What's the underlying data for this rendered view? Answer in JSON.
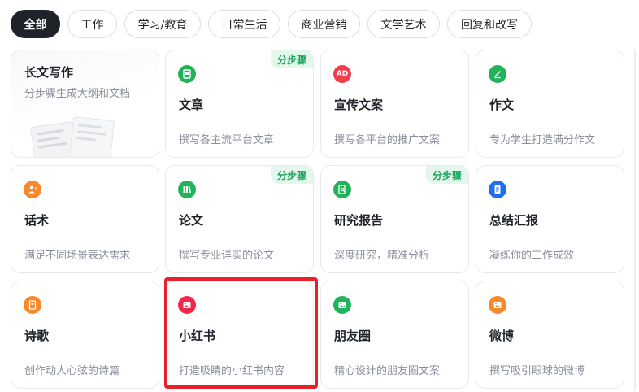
{
  "tabs": [
    {
      "label": "全部",
      "active": true
    },
    {
      "label": "工作"
    },
    {
      "label": "学习/教育"
    },
    {
      "label": "日常生活"
    },
    {
      "label": "商业营销"
    },
    {
      "label": "文学艺术"
    },
    {
      "label": "回复和改写"
    }
  ],
  "cards": [
    {
      "title": "长文写作",
      "desc": "分步骤生成大纲和文档",
      "icon": "document-stack-illustration"
    },
    {
      "title": "文章",
      "desc": "撰写各主流平台文章",
      "icon": "image-doc-icon",
      "icon_color": "#21b35a",
      "badge": "分步骤"
    },
    {
      "title": "宣传文案",
      "desc": "撰写各平台的推广文案",
      "icon": "ad-icon",
      "icon_color": "#f23d4f",
      "icon_text": "AD"
    },
    {
      "title": "作文",
      "desc": "专为学生打造满分作文",
      "icon": "pen-icon",
      "icon_color": "#21b35a"
    },
    {
      "title": "话术",
      "desc": "满足不同场景表达需求",
      "icon": "speaking-person-icon",
      "icon_color": "#f7892b"
    },
    {
      "title": "论文",
      "desc": "撰写专业详实的论文",
      "icon": "books-icon",
      "icon_color": "#21b35a",
      "badge": "分步骤"
    },
    {
      "title": "研究报告",
      "desc": "深度研究，精准分析",
      "icon": "report-search-icon",
      "icon_color": "#21b35a",
      "badge": "分步骤"
    },
    {
      "title": "总结汇报",
      "desc": "凝练你的工作成效",
      "icon": "notebook-icon",
      "icon_color": "#1f6ff0"
    },
    {
      "title": "诗歌",
      "desc": "创作动人心弦的诗篇",
      "icon": "poem-book-icon",
      "icon_color": "#f7892b"
    },
    {
      "title": "小红书",
      "desc": "打造吸睛的小红书内容",
      "icon": "picture-icon",
      "icon_color": "#f0284a"
    },
    {
      "title": "朋友圈",
      "desc": "精心设计的朋友圈文案",
      "icon": "picture-icon",
      "icon_color": "#21b35a"
    },
    {
      "title": "微博",
      "desc": "撰写吸引眼球的微博",
      "icon": "picture-icon",
      "icon_color": "#f7892b"
    }
  ]
}
